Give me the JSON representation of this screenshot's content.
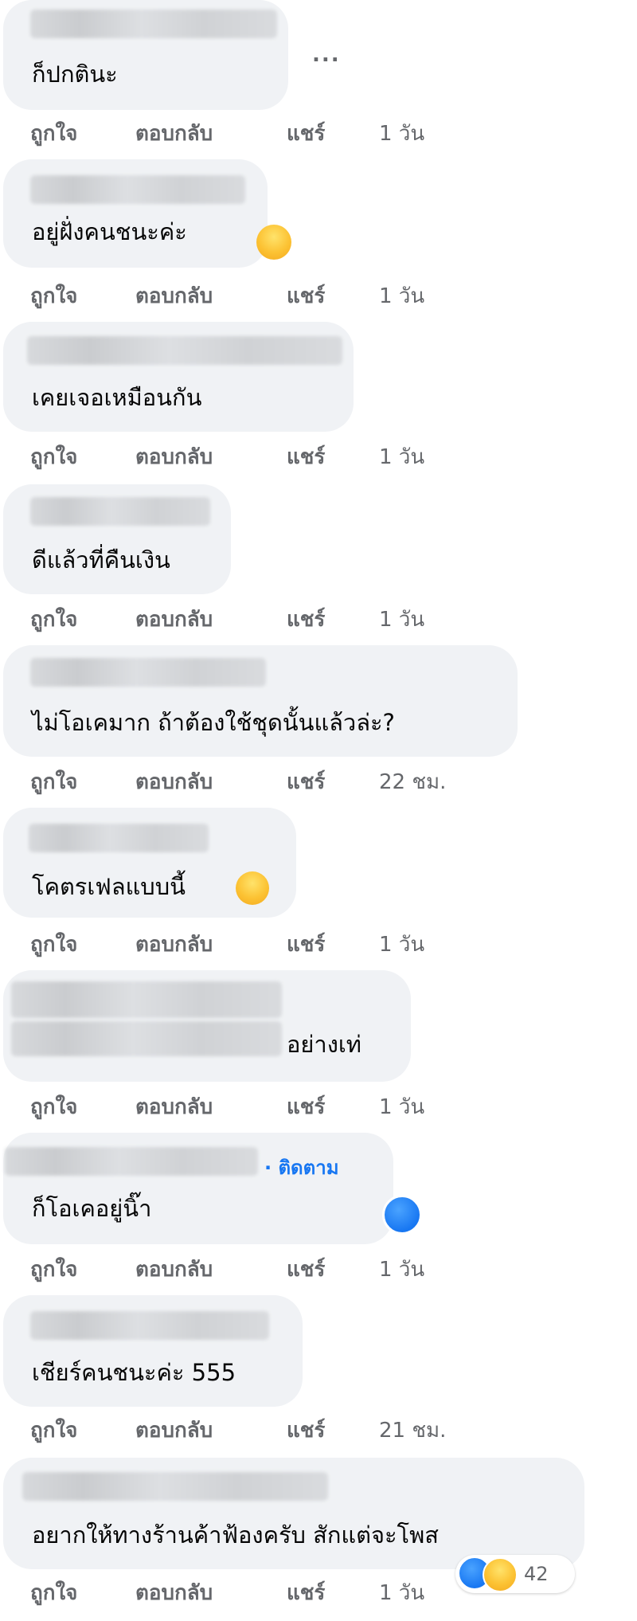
{
  "actions": {
    "like": "ถูกใจ",
    "reply": "ตอบกลับ",
    "share": "แชร์"
  },
  "more_label": "...",
  "comments": [
    {
      "text": "ก็ปกตินะ",
      "time": "1 วัน"
    },
    {
      "text": "อยู่ฝั่งคนชนะค่ะ",
      "time": "1 วัน",
      "reaction_emoji": "grinning-squint-emoji"
    },
    {
      "text": "เคยเจอเหมือนกัน",
      "time": "1 วัน"
    },
    {
      "text": "ดีแล้วที่คืนเงิน",
      "time": "1 วัน"
    },
    {
      "text": "ไม่โอเคมาก ถ้าต้องใช้ชุดนั้นแล้วล่ะ?",
      "time": "22 ชม."
    },
    {
      "text": "โคตรเฟลแบบนี้",
      "time": "1 วัน",
      "reaction_emoji": "pleading-face-emoji"
    },
    {
      "text": "อย่างเท่",
      "time": "1 วัน"
    },
    {
      "text": "ก็โอเคอยู่นิ๊า",
      "time": "1 วัน",
      "follow": "· ติดตาม",
      "reaction": "like"
    },
    {
      "text": "เชียร์คนชนะค่ะ 555",
      "time": "21 ชม."
    },
    {
      "text": "อยากให้ทางร้านค้าฟ้องครับ สักแต่จะโพส",
      "time": "1 วัน",
      "reaction_count": "42"
    }
  ],
  "colors": {
    "bubble": "#f0f2f5",
    "action_text": "#65676b",
    "link": "#1877f2",
    "like_blue": "#1877f2"
  }
}
